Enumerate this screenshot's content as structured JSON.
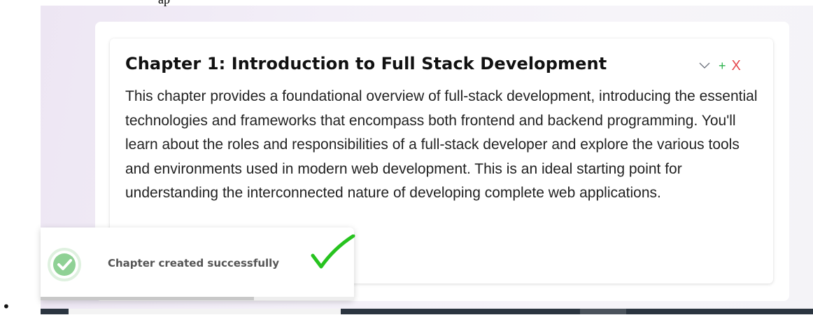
{
  "top_fragment": "ap",
  "chapter": {
    "title": "Chapter 1: Introduction to Full Stack Development",
    "description": "This chapter provides a foundational overview of full-stack development, introducing the essential technologies and frameworks that encompass both frontend and backend programming. You'll learn about the roles and responsibilities of a full-stack developer and explore the various tools and environments used in modern web development. This is an ideal starting point for understanding the interconnected nature of developing complete web applications.",
    "actions": {
      "collapse_icon": "chevron-down-icon",
      "add_label": "+",
      "delete_label": "X"
    }
  },
  "toast": {
    "message": "Chapter created successfully",
    "icon": "check-circle-icon",
    "progress": 0.68
  },
  "colors": {
    "add": "#2bb24c",
    "delete": "#e5484d",
    "success": "#5cc26a",
    "big_check": "#27c31f"
  },
  "bullet": "•"
}
